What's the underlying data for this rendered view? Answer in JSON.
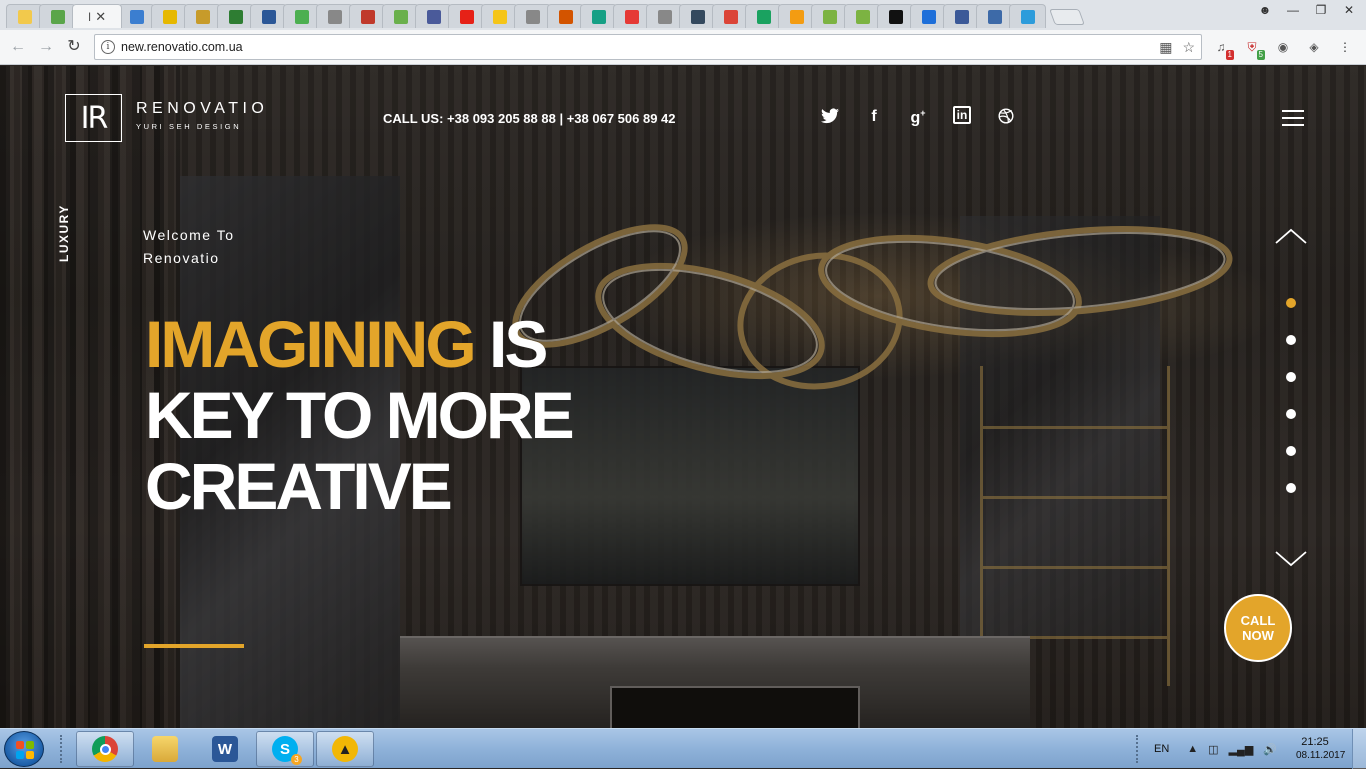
{
  "browser": {
    "tabs": [
      {
        "icon": "browser-tab-icon",
        "color": "#f2c94c",
        "label": ""
      },
      {
        "icon": "mail-tab-icon",
        "color": "#5aa54a",
        "label": ""
      },
      {
        "icon": "renovatio-tab-icon",
        "color": "#444444",
        "label": "I",
        "active": true,
        "close": "✕"
      },
      {
        "icon": "grid-tab-icon",
        "color": "#3b7ed0",
        "label": ""
      },
      {
        "icon": "smile-tab-icon",
        "color": "#e6b800",
        "label": ""
      },
      {
        "icon": "truck-tab-icon",
        "color": "#c79b2a",
        "label": ""
      },
      {
        "icon": "f-tab-icon",
        "color": "#2e7d32",
        "label": ""
      },
      {
        "icon": "w-tab-icon",
        "color": "#2b5797",
        "label": ""
      },
      {
        "icon": "chat-tab-icon",
        "color": "#4caf50",
        "label": ""
      },
      {
        "icon": "doc-tab-icon",
        "color": "#888888",
        "label": ""
      },
      {
        "icon": "bug-tab-icon",
        "color": "#c0392b",
        "label": ""
      },
      {
        "icon": "leaf-tab-icon",
        "color": "#6ab04c",
        "label": ""
      },
      {
        "icon": "v-tab-icon",
        "color": "#4a5a9a",
        "label": ""
      },
      {
        "icon": "youtube-tab-icon",
        "color": "#e62117",
        "label": ""
      },
      {
        "icon": "w-yellow-tab-icon",
        "color": "#f5c518",
        "label": ""
      },
      {
        "icon": "doc-tab-icon",
        "color": "#888888",
        "label": ""
      },
      {
        "icon": "comment-tab-icon",
        "color": "#d35400",
        "label": ""
      },
      {
        "icon": "globe-tab-icon",
        "color": "#16a085",
        "label": ""
      },
      {
        "icon": "e-tab-icon",
        "color": "#e53935",
        "label": ""
      },
      {
        "icon": "doc-tab-icon",
        "color": "#888888",
        "label": ""
      },
      {
        "icon": "t-tab-icon",
        "color": "#34495e",
        "label": ""
      },
      {
        "icon": "gmail-tab-icon",
        "color": "#db4437",
        "label": ""
      },
      {
        "icon": "message-tab-icon",
        "color": "#1aa260",
        "label": ""
      },
      {
        "icon": "at-tab-icon",
        "color": "#f39c12",
        "label": ""
      },
      {
        "icon": "fl-tab-icon",
        "color": "#7cb342",
        "label": ""
      },
      {
        "icon": "fl-tab-icon",
        "color": "#7cb342",
        "label": ""
      },
      {
        "icon": "ain-tab-icon",
        "color": "#111111",
        "label": ""
      },
      {
        "icon": "slash-tab-icon",
        "color": "#1e6fd9",
        "label": ""
      },
      {
        "icon": "facebook-tab-icon",
        "color": "#3b5998",
        "label": ""
      },
      {
        "icon": "play-tab-icon",
        "color": "#3d6aa8",
        "label": ""
      },
      {
        "icon": "x-tab-icon",
        "color": "#2d9cdb",
        "label": ""
      }
    ],
    "url": "new.renovatio.com.ua"
  },
  "site": {
    "logo_mark": "IR",
    "logo_name": "RENOVATIO",
    "logo_sub": "YURI SEH DESIGN",
    "phone": "CALL US: +38 093 205 88 88 | +38 067 506 89 42",
    "socials": [
      "twitter",
      "facebook",
      "google-plus",
      "linkedin",
      "dribbble"
    ],
    "side_label": "LUXURY",
    "welcome_line1": "Welcome To",
    "welcome_line2": "Renovatio",
    "headline_accent": "IMAGINING",
    "headline_rest1": " IS",
    "headline_line2": "KEY TO MORE",
    "headline_line3": "CREATIVE",
    "call_now_line1": "CALL",
    "call_now_line2": "NOW",
    "slide_count": 6,
    "active_slide": 1,
    "accent_color": "#e3a52a"
  },
  "taskbar": {
    "apps": [
      {
        "name": "chrome",
        "pinned": true
      },
      {
        "name": "explorer",
        "pinned": false
      },
      {
        "name": "word",
        "pinned": false
      },
      {
        "name": "skype",
        "pinned": true,
        "badge": "3"
      },
      {
        "name": "app-triangle",
        "pinned": true
      }
    ],
    "lang": "EN",
    "time": "21:25",
    "date": "08.11.2017"
  }
}
